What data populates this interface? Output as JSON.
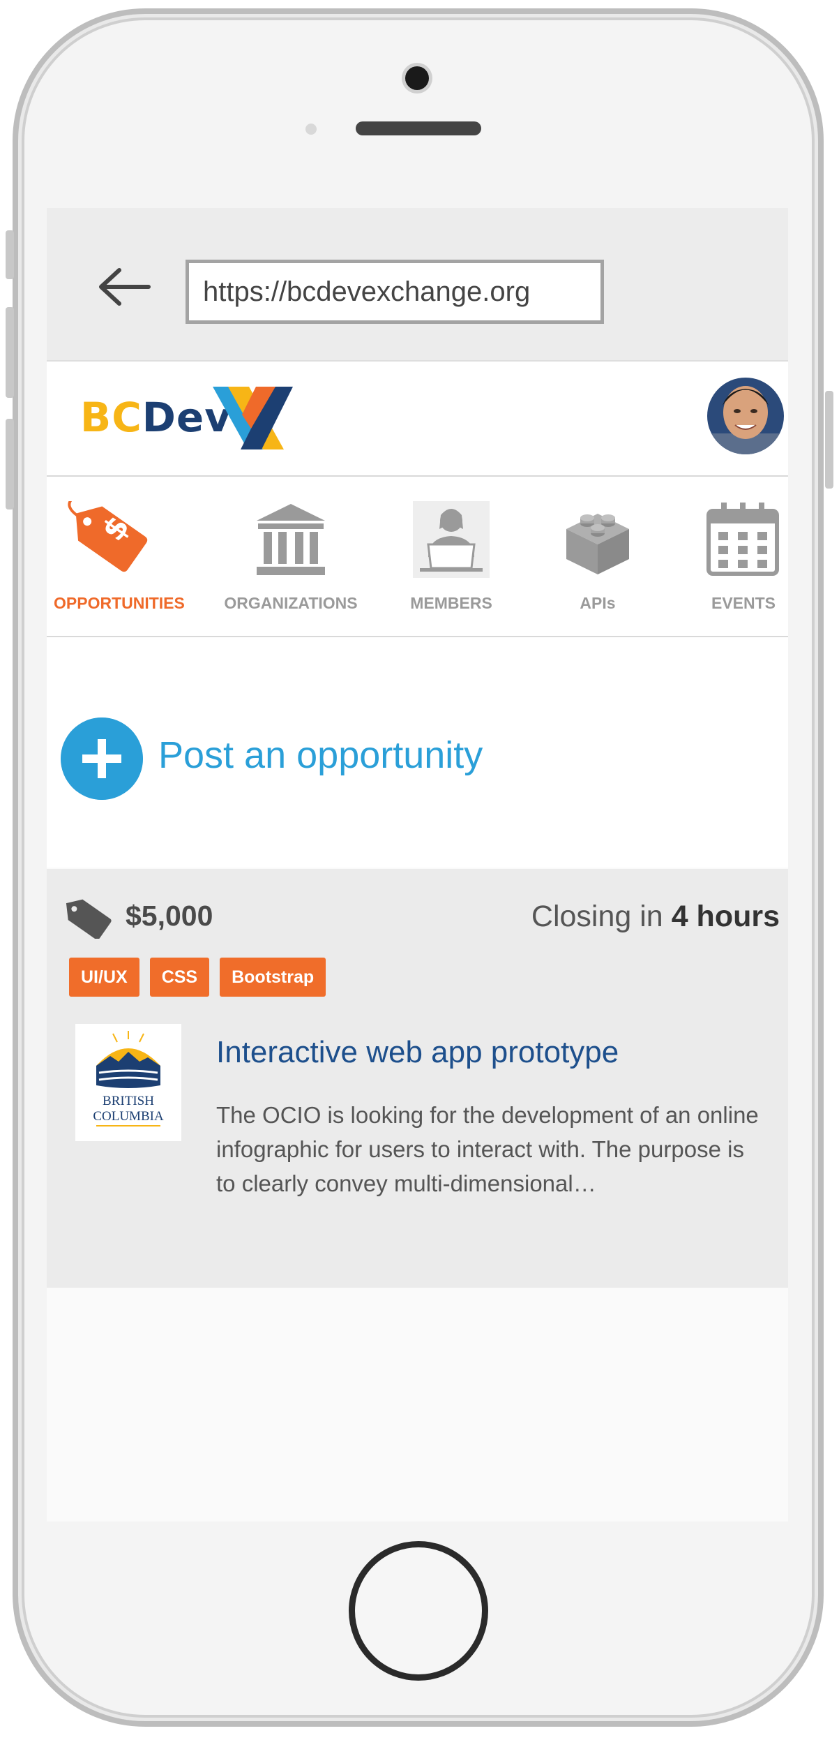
{
  "browser": {
    "url": "https://bcdevexchange.org"
  },
  "header": {
    "logo_bc": "BC",
    "logo_dev": "Dev",
    "logo_brand_colors": [
      "#f7b516",
      "#1c3f72",
      "#ef6a2a",
      "#2a9fd8"
    ]
  },
  "nav": {
    "items": [
      {
        "label": "OPPORTUNITIES",
        "icon": "price-tag-icon",
        "active": true
      },
      {
        "label": "ORGANIZATIONS",
        "icon": "building-icon",
        "active": false
      },
      {
        "label": "MEMBERS",
        "icon": "person-laptop-icon",
        "active": false
      },
      {
        "label": "APIs",
        "icon": "lego-block-icon",
        "active": false
      },
      {
        "label": "EVENTS",
        "icon": "calendar-icon",
        "active": false
      }
    ]
  },
  "post": {
    "label": "Post an opportunity",
    "icon": "plus-icon"
  },
  "opportunity": {
    "price": "$5,000",
    "closing_prefix": "Closing in",
    "closing_value": "4 hours",
    "tags": [
      "UI/UX",
      "CSS",
      "Bootstrap"
    ],
    "org_logo_line1": "BRITISH",
    "org_logo_line2": "COLUMBIA",
    "title": "Interactive web app prototype",
    "description": "The OCIO is looking for the development of an online infographic for users to interact with. The purpose is to clearly convey multi-dimensional…"
  },
  "colors": {
    "accent_orange": "#ef6a2a",
    "accent_blue": "#2a9fd8",
    "title_blue": "#1d4f8c",
    "nav_grey": "#9a9a9a"
  }
}
